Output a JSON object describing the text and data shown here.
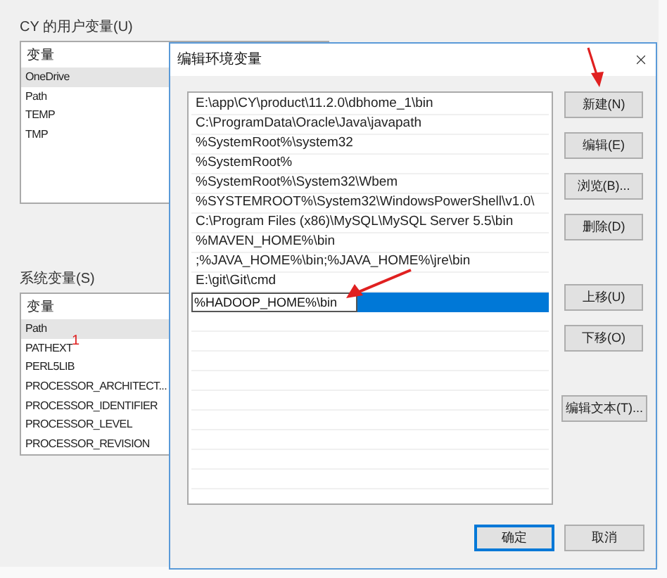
{
  "background_window": {
    "user_vars": {
      "title": "CY 的用户变量(U)",
      "header": "变量",
      "rows": [
        {
          "name": "OneDrive",
          "selected": true
        },
        {
          "name": "Path",
          "selected": false
        },
        {
          "name": "TEMP",
          "selected": false
        },
        {
          "name": "TMP",
          "selected": false
        }
      ]
    },
    "system_vars": {
      "title": "系统变量(S)",
      "header": "变量",
      "rows": [
        {
          "name": "Path",
          "selected": true
        },
        {
          "name": "PATHEXT",
          "selected": false
        },
        {
          "name": "PERL5LIB",
          "selected": false
        },
        {
          "name": "PROCESSOR_ARCHITECT...",
          "selected": false
        },
        {
          "name": "PROCESSOR_IDENTIFIER",
          "selected": false
        },
        {
          "name": "PROCESSOR_LEVEL",
          "selected": false
        },
        {
          "name": "PROCESSOR_REVISION",
          "selected": false
        }
      ]
    }
  },
  "dialog": {
    "title": "编辑环境变量",
    "entries": [
      {
        "text": "E:\\app\\CY\\product\\11.2.0\\dbhome_1\\bin",
        "editing": false
      },
      {
        "text": "C:\\ProgramData\\Oracle\\Java\\javapath",
        "editing": false
      },
      {
        "text": "%SystemRoot%\\system32",
        "editing": false
      },
      {
        "text": "%SystemRoot%",
        "editing": false
      },
      {
        "text": "%SystemRoot%\\System32\\Wbem",
        "editing": false
      },
      {
        "text": "%SYSTEMROOT%\\System32\\WindowsPowerShell\\v1.0\\",
        "editing": false
      },
      {
        "text": "C:\\Program Files (x86)\\MySQL\\MySQL Server 5.5\\bin",
        "editing": false
      },
      {
        "text": "%MAVEN_HOME%\\bin",
        "editing": false
      },
      {
        "text": ";%JAVA_HOME%\\bin;%JAVA_HOME%\\jre\\bin",
        "editing": false
      },
      {
        "text": "E:\\git\\Git\\cmd",
        "editing": false
      },
      {
        "text": "%HADOOP_HOME%\\bin",
        "editing": true
      }
    ],
    "button_groups": [
      [
        "新建(N)",
        "编辑(E)",
        "浏览(B)...",
        "删除(D)"
      ],
      [
        "上移(U)",
        "下移(O)"
      ],
      [
        "编辑文本(T)..."
      ]
    ],
    "footer_buttons": [
      {
        "label": "确定",
        "default": true
      },
      {
        "label": "取消",
        "default": false
      }
    ]
  },
  "annotation_label": "1"
}
